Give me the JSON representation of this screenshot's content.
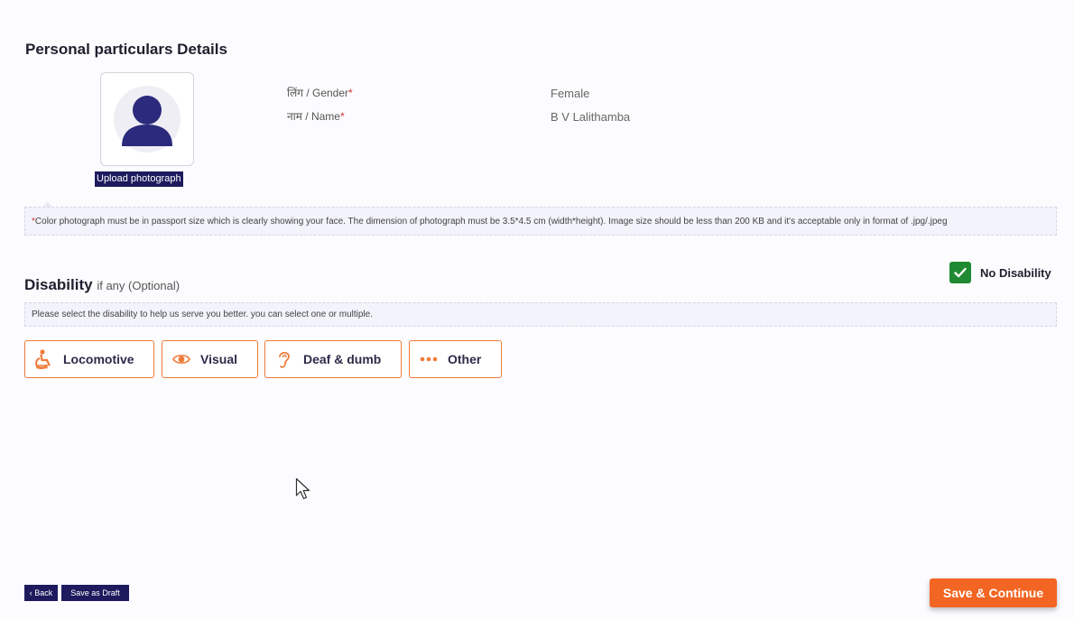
{
  "personal": {
    "section_title": "Personal particulars Details",
    "upload_label": "Upload photograph",
    "gender_label": "लिंग / Gender",
    "gender_value": "Female",
    "name_label": "नाम / Name",
    "name_value": "B V Lalithamba",
    "required_mark": "*",
    "photo_notice": "Color photograph must be in passport size which is clearly showing your face. The dimension of photograph must be 3.5*4.5 cm (width*height). Image size should be less than 200 KB and it's acceptable only in format of .jpg/.jpeg"
  },
  "disability": {
    "title": "Disability",
    "subtitle": "if any (Optional)",
    "no_disability_label": "No Disability",
    "no_disability_checked": true,
    "notice": "Please select the disability to help us serve you better. you can select one or multiple.",
    "options": [
      {
        "label": "Locomotive",
        "icon": "wheelchair-icon"
      },
      {
        "label": "Visual",
        "icon": "eye-icon"
      },
      {
        "label": "Deaf & dumb",
        "icon": "ear-icon"
      },
      {
        "label": "Other",
        "icon": "dots-icon"
      }
    ]
  },
  "footer": {
    "back_label": "‹ Back",
    "draft_label": "Save as Draft",
    "save_label": "Save & Continue"
  },
  "colors": {
    "accent": "#f26522",
    "primary": "#1d1b5e",
    "check": "#1f8a32"
  }
}
